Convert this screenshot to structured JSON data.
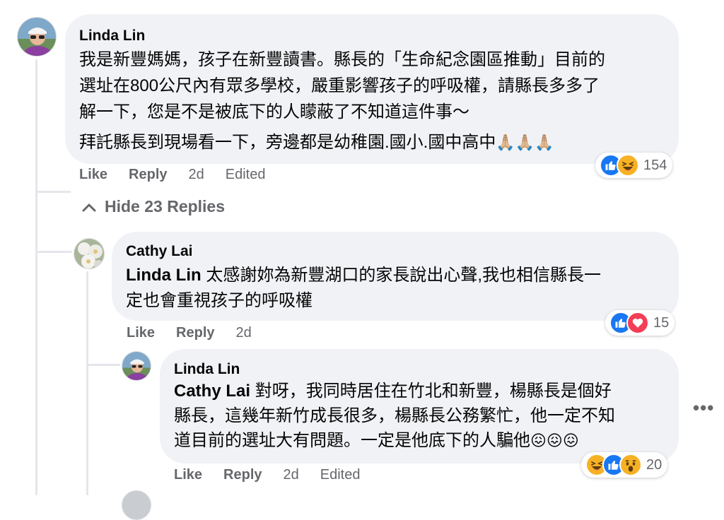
{
  "comment1": {
    "author": "Linda Lin",
    "lines": [
      "我是新豐媽媽，孩子在新豐讀書。縣長的「生命紀念園區推動」目前的",
      "選址在800公尺內有眾多學校，嚴重影響孩子的呼吸權，請縣長多多了",
      "解一下，您是不是被底下的人矇蔽了不知道這件事～",
      "拜託縣長到現場看一下，旁邊都是幼稚園.國小.國中高中"
    ],
    "emoji": "🙏🏼🙏🏼🙏🏼",
    "actions": {
      "like": "Like",
      "reply": "Reply",
      "time": "2d",
      "edited": "Edited"
    },
    "reactions": {
      "icons": [
        "like-reaction",
        "haha-reaction"
      ],
      "count": "154"
    }
  },
  "hide_replies": {
    "label": "Hide 23 Replies",
    "icon": "chevron-up-icon"
  },
  "reply1": {
    "author": "Cathy Lai",
    "mention": "Linda Lin",
    "lines": [
      " 太感謝妳為新豐湖口的家長說出心聲,我也相信縣長一",
      "定也會重視孩子的呼吸權"
    ],
    "actions": {
      "like": "Like",
      "reply": "Reply",
      "time": "2d"
    },
    "reactions": {
      "icons": [
        "like-reaction",
        "love-reaction"
      ],
      "count": "15"
    }
  },
  "reply2": {
    "author": "Linda Lin",
    "mention": "Cathy Lai",
    "lines": [
      " 對呀，我同時居住在竹北和新豐，楊縣長是個好",
      "縣長，這幾年新竹成長很多，楊縣長公務繁忙，他一定不知",
      "道目前的選址大有問題。一定是他底下的人騙他"
    ],
    "emoji": "😖😖😖",
    "actions": {
      "like": "Like",
      "reply": "Reply",
      "time": "2d",
      "edited": "Edited"
    },
    "reactions": {
      "icons": [
        "haha-reaction",
        "like-reaction",
        "wow-reaction"
      ],
      "count": "20"
    }
  },
  "more_options": "•••",
  "colors": {
    "bubble": "#f0f2f5",
    "like_blue": "#1877f2",
    "love_red": "#f33e58",
    "haha_yellow": "#f7b125",
    "meta_gray": "#65676b"
  }
}
